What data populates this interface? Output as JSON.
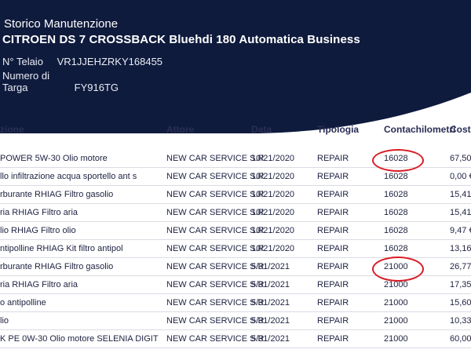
{
  "header": {
    "title": "Storico Manutenzione",
    "model": "CITROEN DS 7 CROSSBACK Bluehdi 180 Automatica Business",
    "telaio_label": "N° Telaio",
    "telaio_value": "VR1JJEHZRKY168455",
    "targa_label": "Numero di Targa",
    "targa_value": "FY916TG"
  },
  "table": {
    "columns": [
      "zione",
      "Attore",
      "Data",
      "Tipologia",
      "Contachilometri",
      "Costo"
    ],
    "rows": [
      {
        "desc": "POWER 5W-30  Olio motore",
        "actor": "NEW CAR SERVICE S.R",
        "date": "10/21/2020",
        "type": "REPAIR",
        "km": "16028",
        "cost": "67,50"
      },
      {
        "desc": "llo infiltrazione acqua sportello ant s",
        "actor": "NEW CAR SERVICE S.R",
        "date": "10/21/2020",
        "type": "REPAIR",
        "km": "16028",
        "cost": "0,00 €"
      },
      {
        "desc": "rburante RHIAG  Filtro gasolio",
        "actor": "NEW CAR SERVICE S.R",
        "date": "10/21/2020",
        "type": "REPAIR",
        "km": "16028",
        "cost": "15,41"
      },
      {
        "desc": "ria RHIAG  Filtro aria",
        "actor": "NEW CAR SERVICE S.R",
        "date": "10/21/2020",
        "type": "REPAIR",
        "km": "16028",
        "cost": "15,41"
      },
      {
        "desc": "lio RHIAG  Filtro olio",
        "actor": "NEW CAR SERVICE S.R",
        "date": "10/21/2020",
        "type": "REPAIR",
        "km": "16028",
        "cost": "9,47 €"
      },
      {
        "desc": "ntipolline RHIAG  Kit filtro antipol",
        "actor": "NEW CAR SERVICE S.R",
        "date": "10/21/2020",
        "type": "REPAIR",
        "km": "16028",
        "cost": "13,16"
      },
      {
        "desc": "rburante RHIAG  Filtro gasolio",
        "actor": "NEW CAR SERVICE S.R",
        "date": "5/31/2021",
        "type": "REPAIR",
        "km": "21000",
        "cost": "26,77"
      },
      {
        "desc": "ria RHIAG  Filtro aria",
        "actor": "NEW CAR SERVICE S.R",
        "date": "5/31/2021",
        "type": "REPAIR",
        "km": "21000",
        "cost": "17,35"
      },
      {
        "desc": "o antipolline",
        "actor": "NEW CAR SERVICE S.R",
        "date": "5/31/2021",
        "type": "REPAIR",
        "km": "21000",
        "cost": "15,60"
      },
      {
        "desc": "lio",
        "actor": "NEW CAR SERVICE S.R",
        "date": "5/31/2021",
        "type": "REPAIR",
        "km": "21000",
        "cost": "10,33"
      },
      {
        "desc": "K PE 0W-30  Olio motore SELENIA  DIGIT",
        "actor": "NEW CAR SERVICE S.R",
        "date": "5/31/2021",
        "type": "REPAIR",
        "km": "21000",
        "cost": "60,00"
      }
    ]
  },
  "colors": {
    "header_bg": "#0f1b3d",
    "annotation_circle": "#d91c24"
  }
}
